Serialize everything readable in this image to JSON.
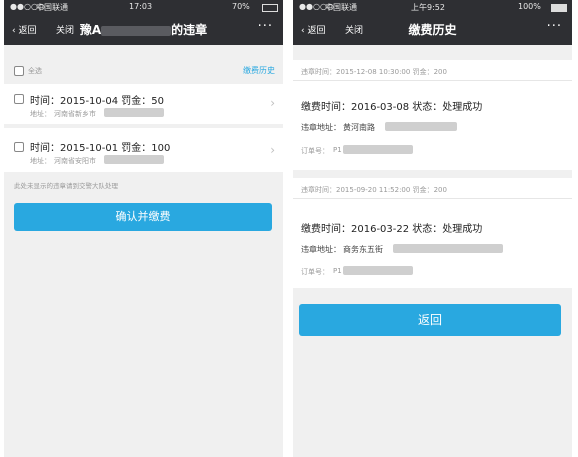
{
  "left": {
    "status": {
      "carrier": "中国联通",
      "time": "17:03",
      "battery": "70%"
    },
    "nav": {
      "back_label": "返回",
      "close_label": "关闭",
      "title_prefix": "豫A",
      "title_suffix": "的违章",
      "more": "···"
    },
    "select_all_label": "全选",
    "history_link": "缴费历史",
    "items": [
      {
        "line": "时间：2015-10-04 罚金：50",
        "addr_label": "地址：",
        "addr_value": "河南省新乡市"
      },
      {
        "line": "时间：2015-10-01 罚金：100",
        "addr_label": "地址：",
        "addr_value": "河南省安阳市"
      }
    ],
    "note": "此处未显示的违章请到交警大队处理",
    "confirm_button": "确认并缴费"
  },
  "right": {
    "status": {
      "carrier": "中国联通",
      "time": "上午9:52",
      "battery": "100%"
    },
    "nav": {
      "back_label": "返回",
      "close_label": "关闭",
      "title": "缴费历史",
      "more": "···"
    },
    "records": [
      {
        "header": "违章时间：2015-12-08 10:30:00 罚金：200",
        "pay_line": "缴费时间：2016-03-08 状态：处理成功",
        "addr_label": "违章地址：",
        "addr_value": "黄河南路",
        "order_label": "订单号：",
        "order_value": "P1"
      },
      {
        "header": "违章时间：2015-09-20 11:52:00 罚金：200",
        "pay_line": "缴费时间：2016-03-22 状态：处理成功",
        "addr_label": "违章地址：",
        "addr_value": "商务东五街",
        "order_label": "订单号：",
        "order_value": "P1"
      }
    ],
    "return_button": "返回"
  },
  "colors": {
    "navbar": "#2e2f33",
    "accent": "#29a8e0",
    "background": "#f0f0f0"
  }
}
